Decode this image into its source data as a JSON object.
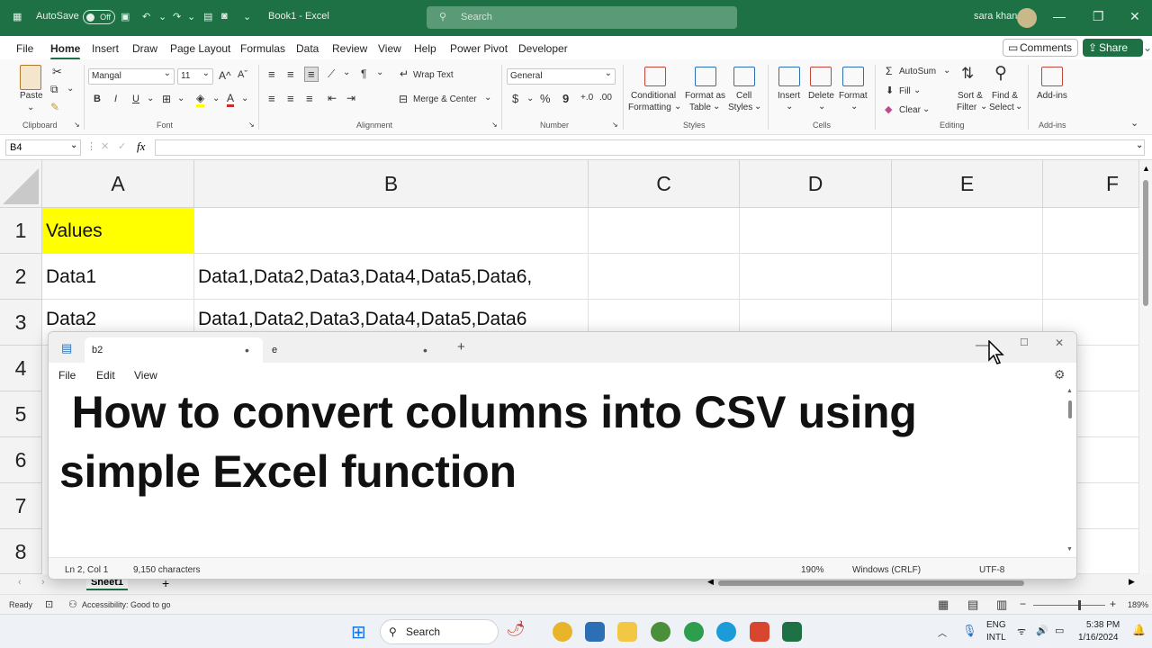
{
  "titlebar": {
    "autosave_label": "AutoSave",
    "autosave_state": "Off",
    "doc_title": "Book1 - Excel",
    "search_placeholder": "Search",
    "user_name": "sara khan"
  },
  "menu": {
    "tabs": [
      "File",
      "Home",
      "Insert",
      "Draw",
      "Page Layout",
      "Formulas",
      "Data",
      "Review",
      "View",
      "Help",
      "Power Pivot",
      "Developer"
    ],
    "active_tab": "Home",
    "comments_label": "Comments",
    "share_label": "Share"
  },
  "ribbon": {
    "clipboard": {
      "paste": "Paste",
      "label": "Clipboard"
    },
    "font": {
      "name": "Mangal",
      "size": "11",
      "bold": "B",
      "italic": "I",
      "underline": "U",
      "label": "Font"
    },
    "alignment": {
      "wrap_text": "Wrap Text",
      "merge_center": "Merge & Center",
      "label": "Alignment"
    },
    "number": {
      "format": "General",
      "currency": "$",
      "percent": "%",
      "comma": "9",
      "label": "Number"
    },
    "styles": {
      "conditional": "Conditional",
      "conditional2": "Formatting",
      "format_as": "Format as",
      "format_as2": "Table",
      "cell": "Cell",
      "cell2": "Styles",
      "label": "Styles"
    },
    "cells": {
      "insert": "Insert",
      "delete": "Delete",
      "format": "Format",
      "label": "Cells"
    },
    "editing": {
      "autosum": "AutoSum",
      "fill": "Fill",
      "clear": "Clear",
      "sort": "Sort &",
      "sort2": "Filter",
      "find": "Find &",
      "find2": "Select",
      "label": "Editing"
    },
    "addins": {
      "btn": "Add-ins",
      "label": "Add-ins"
    }
  },
  "formula_bar": {
    "name_box": "B4",
    "fx": "fx",
    "content": ""
  },
  "grid": {
    "columns": [
      "A",
      "B",
      "C",
      "D",
      "E",
      "F"
    ],
    "rows": [
      "1",
      "2",
      "3",
      "4",
      "5",
      "6",
      "7",
      "8"
    ],
    "cells": {
      "A1": "Values",
      "A2": "Data1",
      "B2": "Data1,Data2,Data3,Data4,Data5,Data6,",
      "A3": "Data2",
      "B3": "Data1,Data2,Data3,Data4,Data5,Data6"
    },
    "highlight_color": "#ffff00"
  },
  "sheets": {
    "active": "Sheet1"
  },
  "status": {
    "ready": "Ready",
    "accessibility": "Accessibility: Good to go",
    "zoom": "189%"
  },
  "notepad": {
    "tabs": [
      {
        "title": "b2",
        "active": true
      },
      {
        "title": "e",
        "active": false
      }
    ],
    "menu": [
      "File",
      "Edit",
      "View"
    ],
    "text_line1": " How to convert columns into CSV using",
    "text_line2": "simple Excel function",
    "status": {
      "position": "Ln 2, Col 1",
      "chars": "9,150 characters",
      "zoom": "190%",
      "eol": "Windows (CRLF)",
      "encoding": "UTF-8"
    }
  },
  "taskbar": {
    "search_label": "Search",
    "lang1": "ENG",
    "lang2": "INTL",
    "time": "5:38 PM",
    "date": "1/16/2024"
  },
  "colors": {
    "excel_green": "#1e7145",
    "cell_highlight": "#ffff00"
  }
}
